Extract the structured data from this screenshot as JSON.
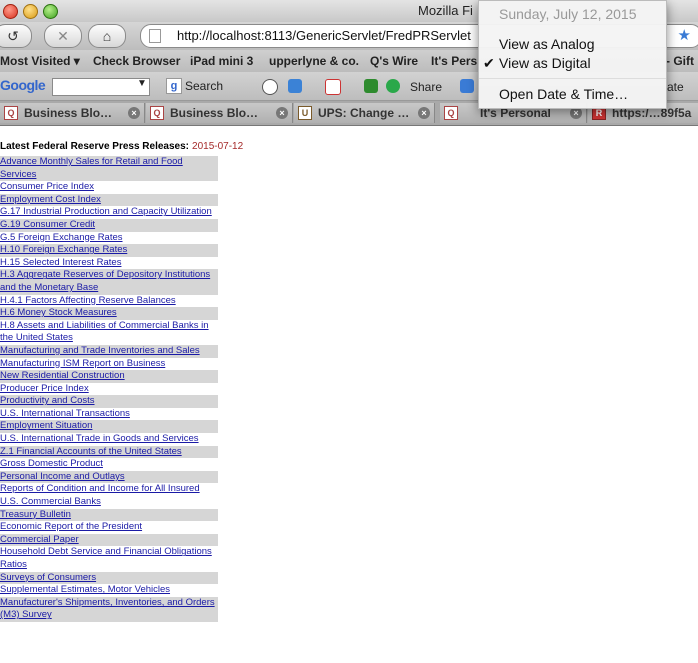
{
  "window": {
    "title": "Mozilla Fi"
  },
  "navigation": {
    "back_glyph": "↺",
    "forward_glyph": "✕",
    "home_glyph": "⌂",
    "url": "http://localhost:8113/GenericServlet/FredPRServlet"
  },
  "bookmarks": [
    "Most Visited ▾",
    "Check Browser",
    "iPad mini 3",
    "upperlyne & co.",
    "Q's Wire",
    "It's Pers",
    "- Gift"
  ],
  "google_toolbar": {
    "logo": "Google",
    "search_label": "Search",
    "share_label": "Share",
    "right_label": "ate"
  },
  "tabs": [
    {
      "label": "Business Blo…",
      "icon": "Q"
    },
    {
      "label": "Business Blo…",
      "icon": "Q"
    },
    {
      "label": "UPS: Change …",
      "icon": "U"
    },
    {
      "label": "It's Personal",
      "icon": "Q"
    },
    {
      "label": "https:/…89f5a",
      "icon": "R"
    }
  ],
  "content": {
    "heading": "Latest Federal Reserve Press Releases:",
    "date": "2015-07-12",
    "releases": [
      "Advance Monthly Sales for Retail and Food Services",
      "Consumer Price Index",
      "Employment Cost Index",
      "G.17 Industrial Production and Capacity Utilization",
      "G.19 Consumer Credit",
      "G.5 Foreign Exchange Rates",
      "H.10 Foreign Exchange Rates",
      "H.15 Selected Interest Rates",
      "H.3 Aggregate Reserves of Depository Institutions and the Monetary Base",
      "H.4.1 Factors Affecting Reserve Balances",
      "H.6 Money Stock Measures",
      "H.8 Assets and Liabilities of Commercial Banks in the United States",
      "Manufacturing and Trade Inventories and Sales",
      "Manufacturing ISM Report on Business",
      "New Residential Construction",
      "Producer Price Index",
      "Productivity and Costs",
      "U.S. International Transactions",
      "Employment Situation",
      "U.S. International Trade in Goods and Services",
      "Z.1 Financial Accounts of the United States",
      "Gross Domestic Product",
      "Personal Income and Outlays",
      "Reports of Condition and Income for All Insured U.S. Commercial Banks",
      "Treasury Bulletin",
      "Economic Report of the President",
      "Commercial Paper",
      "Household Debt Service and Financial Obligations Ratios",
      "Surveys of Consumers",
      "Supplemental Estimates, Motor Vehicles",
      "Manufacturer's Shipments, Inventories, and Orders (M3) Survey"
    ]
  },
  "clock_menu": {
    "date": "Sunday, July 12, 2015",
    "analog": "View as Analog",
    "digital": "View as Digital",
    "checkmark": "✔",
    "open": "Open Date & Time…"
  }
}
